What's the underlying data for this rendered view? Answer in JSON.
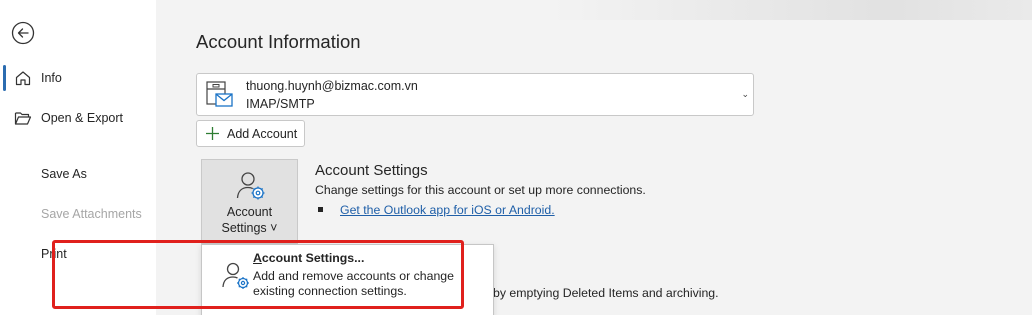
{
  "sidebar": {
    "back_icon": "back-arrow-icon",
    "items": [
      {
        "label": "Info",
        "icon": "home-icon",
        "active": true
      },
      {
        "label": "Open & Export",
        "icon": "folder-open-icon"
      },
      {
        "label": "Save As"
      },
      {
        "label": "Save Attachments",
        "disabled": true
      },
      {
        "label": "Print"
      }
    ]
  },
  "main": {
    "title": "Account Information",
    "account": {
      "email": "thuong.huynh@bizmac.com.vn",
      "type": "IMAP/SMTP",
      "icon": "mail-account-icon"
    },
    "add_account_label": "Add Account",
    "settings_button": {
      "line1": "Account",
      "line2": "Settings ˅"
    },
    "section": {
      "title": "Account Settings",
      "description": "Change settings for this account or set up more connections.",
      "link": "Get the Outlook app for iOS or Android.",
      "partial_text": "by emptying Deleted Items and archiving."
    },
    "dropdown": {
      "item_title_accel": "A",
      "item_title_rest": "ccount Settings...",
      "desc_line1": "Add and remove accounts or change",
      "desc_line2": "existing connection settings."
    }
  },
  "colors": {
    "accent": "#2b6cb0",
    "highlight_border": "#e0201c",
    "link": "#1f5fa8"
  }
}
